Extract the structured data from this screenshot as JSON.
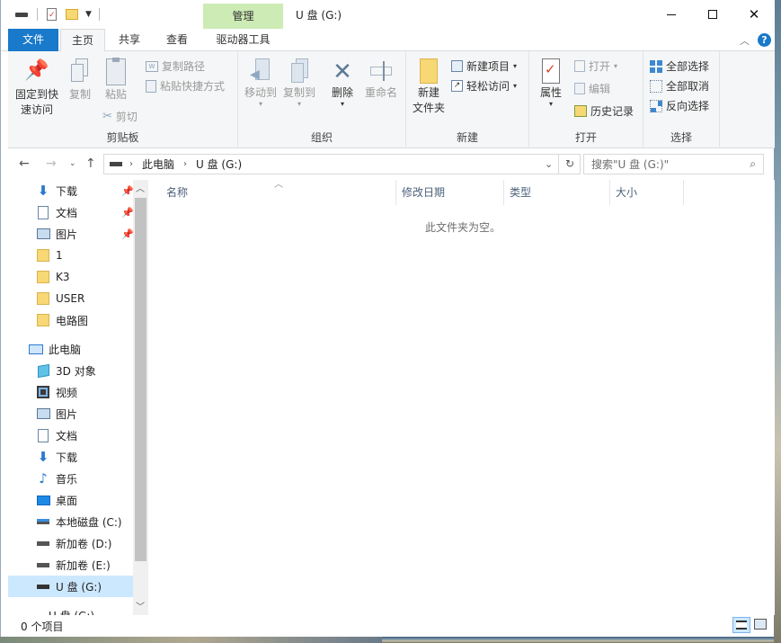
{
  "window": {
    "title": "U 盘 (G:)",
    "context_tab": "管理",
    "min": "—",
    "max": "☐",
    "close": "✕"
  },
  "tabs": [
    {
      "label": "文件"
    },
    {
      "label": "主页"
    },
    {
      "label": "共享"
    },
    {
      "label": "查看"
    },
    {
      "label": "驱动器工具"
    }
  ],
  "ribbon": {
    "clipboard": {
      "label": "剪贴板",
      "pin": "固定到快\n速访问",
      "pin1": "固定到快",
      "pin2": "速访问",
      "copy": "复制",
      "paste": "粘贴",
      "copy_path": "复制路径",
      "paste_shortcut": "粘贴快捷方式",
      "cut": "剪切"
    },
    "organize": {
      "label": "组织",
      "move_to": "移动到",
      "copy_to": "复制到",
      "delete": "删除",
      "rename": "重命名"
    },
    "new": {
      "label": "新建",
      "new_folder1": "新建",
      "new_folder2": "文件夹",
      "new_item": "新建项目",
      "easy_access": "轻松访问"
    },
    "open": {
      "label": "打开",
      "properties": "属性",
      "open": "打开",
      "edit": "编辑",
      "history": "历史记录"
    },
    "select": {
      "label": "选择",
      "select_all": "全部选择",
      "select_none": "全部取消",
      "invert": "反向选择"
    }
  },
  "address": {
    "segments": [
      "此电脑",
      "U 盘 (G:)"
    ],
    "search_placeholder": "搜索\"U 盘 (G:)\""
  },
  "nav": {
    "quick": [
      {
        "label": "下载"
      },
      {
        "label": "文档"
      },
      {
        "label": "图片"
      },
      {
        "label": "1"
      },
      {
        "label": "K3"
      },
      {
        "label": "USER"
      },
      {
        "label": "电路图"
      }
    ],
    "pc": "此电脑",
    "pc_items": [
      {
        "label": "3D 对象"
      },
      {
        "label": "视频"
      },
      {
        "label": "图片"
      },
      {
        "label": "文档"
      },
      {
        "label": "下载"
      },
      {
        "label": "音乐"
      },
      {
        "label": "桌面"
      },
      {
        "label": "本地磁盘 (C:)"
      },
      {
        "label": "新加卷 (D:)"
      },
      {
        "label": "新加卷 (E:)"
      },
      {
        "label": "U 盘 (G:)"
      },
      {
        "label": "U 盘 (G:)"
      }
    ]
  },
  "columns": [
    {
      "label": "名称"
    },
    {
      "label": "修改日期"
    },
    {
      "label": "类型"
    },
    {
      "label": "大小"
    }
  ],
  "empty_text": "此文件夹为空。",
  "status": {
    "count": "0 个项目"
  },
  "colors": {
    "accent": "#1979ca",
    "context": "#cdebb4",
    "selected": "#cce8ff"
  }
}
